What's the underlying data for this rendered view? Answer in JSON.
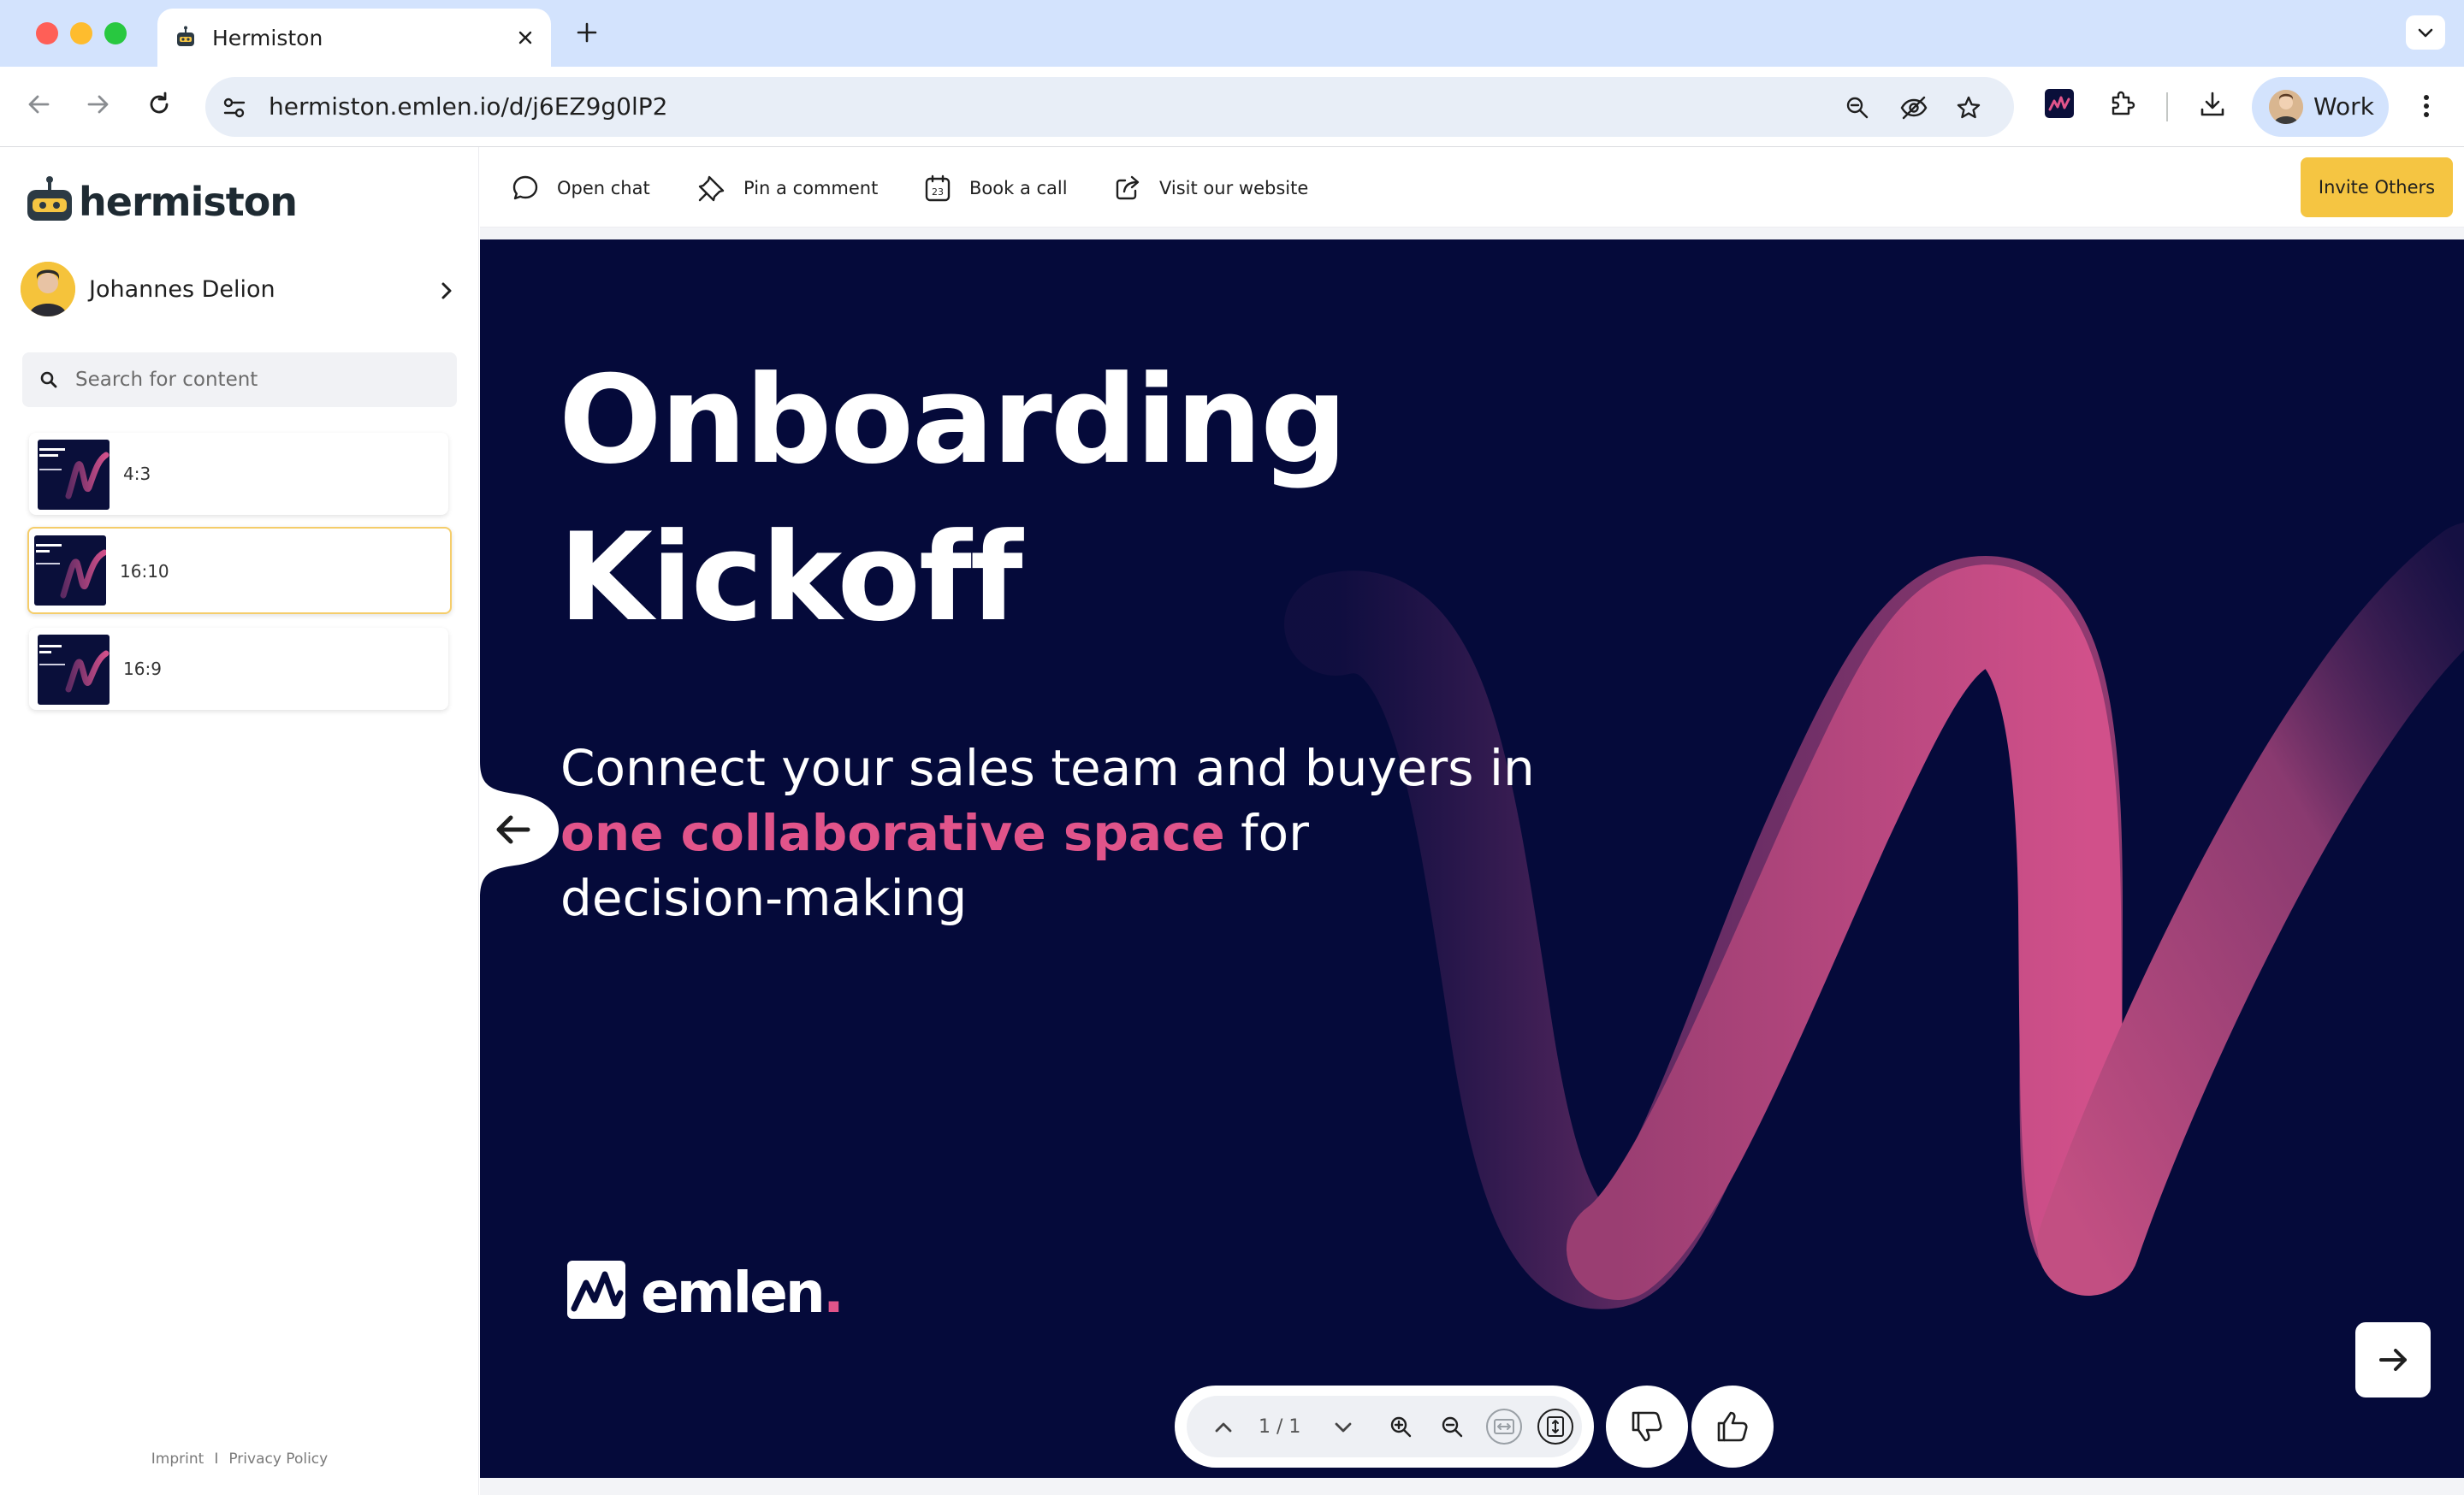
{
  "browser": {
    "tab_title": "Hermiston",
    "url": "hermiston.emlen.io/d/j6EZ9g0lP2",
    "profile_label": "Work"
  },
  "sidebar": {
    "brand": "hermiston",
    "user_name": "Johannes Delion",
    "search_placeholder": "Search for content",
    "items": [
      {
        "label": "4:3",
        "active": false
      },
      {
        "label": "16:10",
        "active": true
      },
      {
        "label": "16:9",
        "active": false
      }
    ],
    "footer": {
      "imprint": "Imprint",
      "separator": "I",
      "privacy": "Privacy Policy"
    }
  },
  "actions": {
    "open_chat": "Open chat",
    "pin_comment": "Pin a comment",
    "book_call": "Book a call",
    "visit_website": "Visit our website",
    "invite": "Invite Others"
  },
  "slide": {
    "title_line1": "Onboarding",
    "title_line2": "Kickoff",
    "subtitle_start": "Connect your sales team and buyers in ",
    "subtitle_highlight": "one collaborative space",
    "subtitle_end": " for decision-making",
    "brand": "emlen",
    "brand_dot": "."
  },
  "viewer": {
    "page_indicator": "1 / 1"
  },
  "colors": {
    "slide_bg": "#050a3a",
    "accent_pink": "#e1548a",
    "invite_button": "#f5c542",
    "active_item_border": "#f5cd6a"
  }
}
